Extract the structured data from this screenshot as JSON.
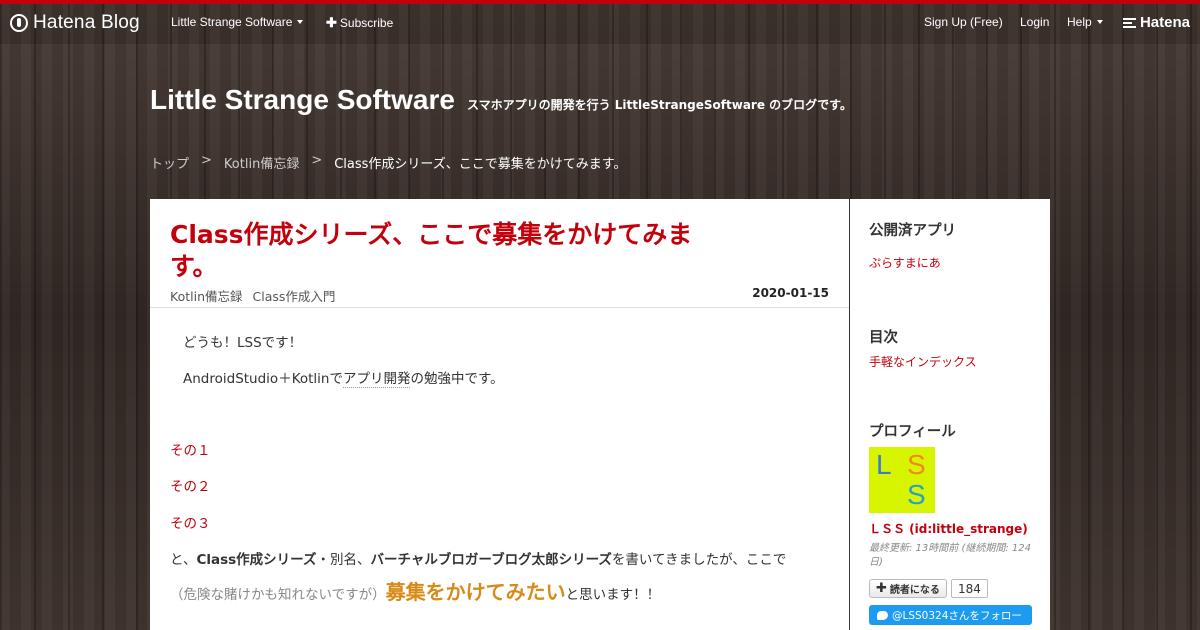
{
  "header": {
    "brand": "Hatena Blog",
    "blog_menu": "Little Strange Software",
    "subscribe": "Subscribe",
    "signup": "Sign Up (Free)",
    "login": "Login",
    "help": "Help",
    "hatena": "Hatena"
  },
  "blog": {
    "title": "Little Strange Software",
    "description": "スマホアプリの開発を行う LittleStrangeSoftware のブログです。"
  },
  "breadcrumb": {
    "top": "トップ",
    "sep": ">",
    "category": "Kotlin備忘録",
    "current": "Class作成シリーズ、ここで募集をかけてみます。"
  },
  "entry": {
    "title": "Class作成シリーズ、ここで募集をかけてみます。",
    "categories": [
      "Kotlin備忘録",
      "Class作成入門"
    ],
    "date": "2020-01-15",
    "p1": "どうも！LSSです！",
    "p2_pre": "AndroidStudio＋Kotlinで",
    "p2_link": "アプリ開発",
    "p2_post": "の勉強中です。",
    "link1": "その１",
    "link2": "その２",
    "link3": "その３",
    "p3_a": "と、",
    "p3_b": "Class作成シリーズ",
    "p3_c": "・別名、",
    "p3_d": "バーチャルブロガーブログ太郎シリーズ",
    "p3_e": "を書いてきましたが、ここで",
    "p4_a": "（危険な賭けかも知れないですが）",
    "p4_b": "募集をかけてみたい",
    "p4_c": "と思います！！"
  },
  "sidebar": {
    "apps_title": "公開済アプリ",
    "apps_link": "ぷらすまにあ",
    "toc_title": "目次",
    "toc_link": "手軽なインデックス",
    "profile_title": "プロフィール",
    "avatar_letters": [
      "L",
      "S",
      "S"
    ],
    "profile_name": "ＬＳＳ (id:little_strange)",
    "profile_meta": "最終更新: 13時間前 (継続期間: 124 日)",
    "reader_button": "読者になる",
    "reader_count": "184",
    "follow_button": "@LSS0324さんをフォロー"
  }
}
